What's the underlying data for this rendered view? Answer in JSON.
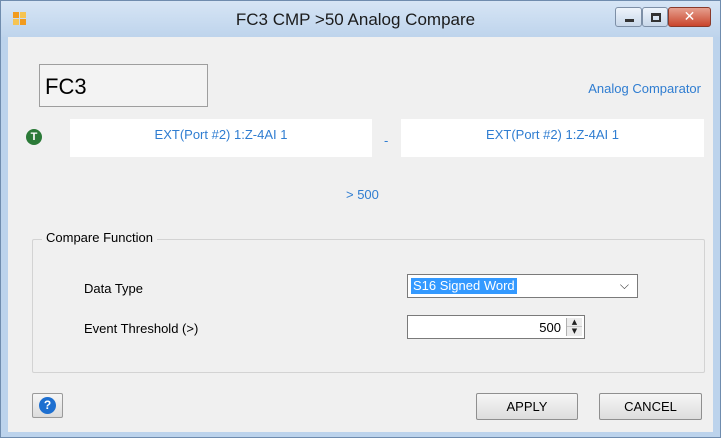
{
  "window": {
    "title": "FC3 CMP >50 Analog Compare",
    "icons": {
      "app": "app-icon",
      "minimize": "minimize-icon",
      "maximize": "maximize-icon",
      "close": "close-icon"
    },
    "close_color": "#c9452c"
  },
  "header": {
    "function_code": "FC3",
    "type_label": "Analog Comparator"
  },
  "operands": {
    "icon": "t-status-icon",
    "icon_letter": "T",
    "left": "EXT(Port #2) 1:Z-4AI 1",
    "separator": "-",
    "right": "EXT(Port #2) 1:Z-4AI 1",
    "comparison": "> 500"
  },
  "compare_function": {
    "title": "Compare Function",
    "data_type_label": "Data Type",
    "data_type_value": "S16 Signed Word",
    "threshold_label": "Event Threshold (>)",
    "threshold_value": "500"
  },
  "footer": {
    "help_icon": "help-icon",
    "help_glyph": "?",
    "apply_label": "APPLY",
    "cancel_label": "CANCEL"
  },
  "colors": {
    "accent_text": "#2f7dd1",
    "selection": "#3399ff",
    "status_green": "#2b7a38"
  }
}
